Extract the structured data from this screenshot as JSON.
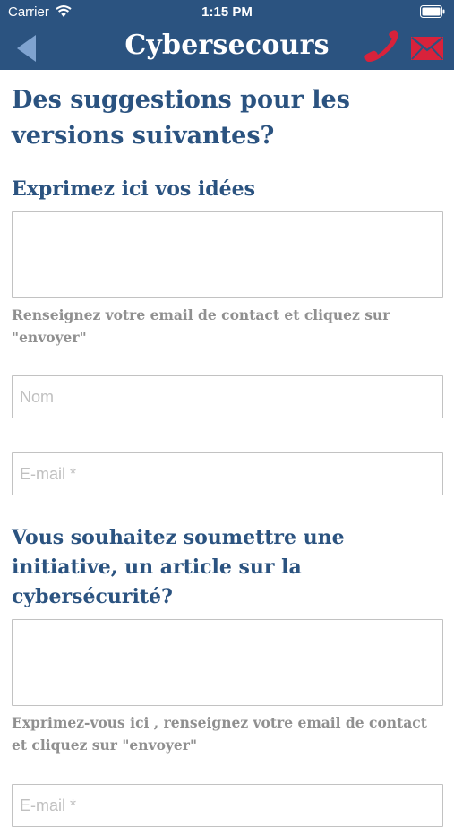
{
  "status_bar": {
    "carrier": "Carrier",
    "time": "1:15 PM"
  },
  "nav": {
    "title": "Cybersecours",
    "back_icon": "back-arrow-icon",
    "phone_icon": "phone-icon",
    "mail_icon": "mail-icon"
  },
  "colors": {
    "primary": "#2b5380",
    "accent": "#d8223b",
    "note": "#909090",
    "border": "#c2c2c2"
  },
  "form": {
    "suggestions_title": "Des suggestions pour les versions suivantes?",
    "ideas_label": "Exprimez ici vos idées",
    "ideas_value": "",
    "contact_hint": "Renseignez votre email de contact et cliquez sur \"envoyer\"",
    "name_placeholder": "Nom",
    "email_placeholder": "E-mail *",
    "initiative_title": "Vous souhaitez  soumettre une initiative, un article sur la cybersécurité?",
    "initiative_value": "",
    "initiative_hint": "Exprimez-vous ici , renseignez votre email de contact et cliquez sur \"envoyer\"",
    "email2_placeholder": "E-mail *"
  }
}
